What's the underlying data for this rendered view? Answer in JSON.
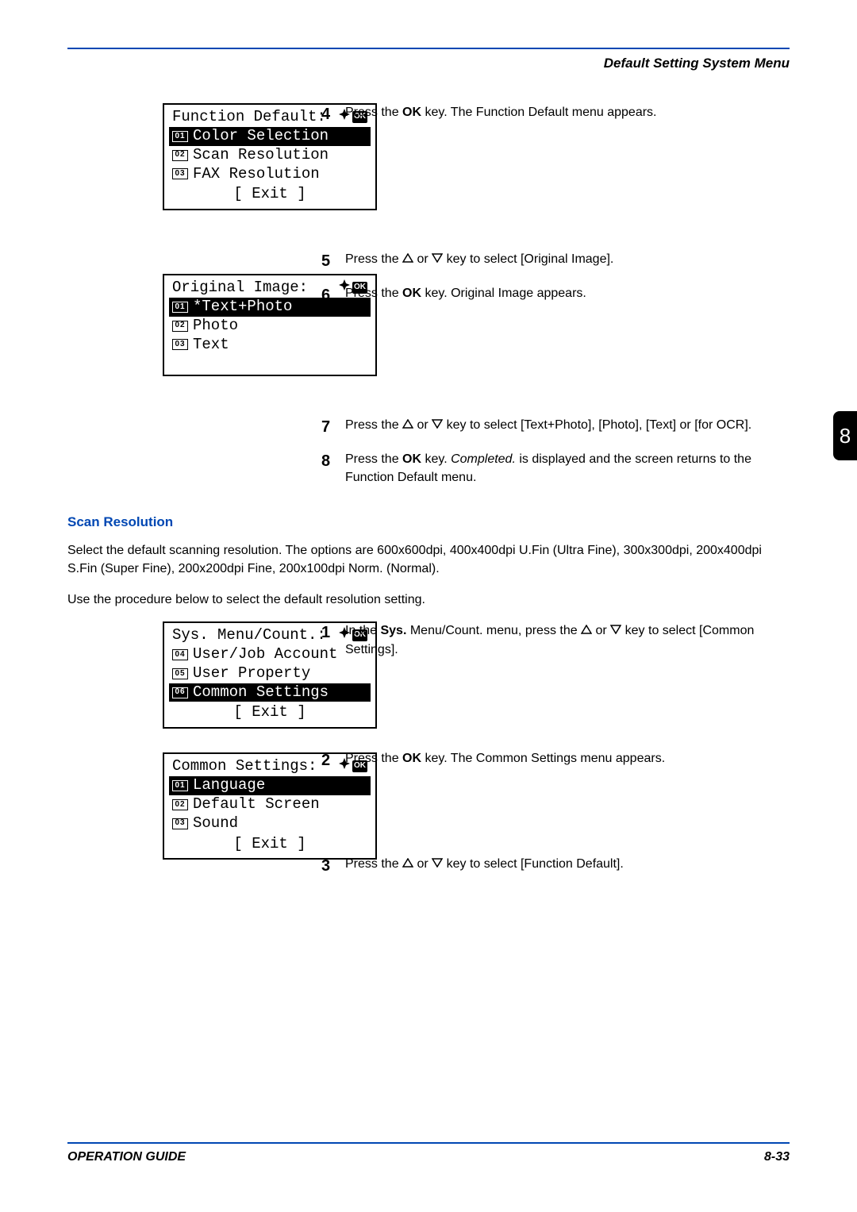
{
  "header": "Default Setting System Menu",
  "chapter": "8",
  "lcd1": {
    "title": "Function Default:",
    "items": [
      {
        "num": "01",
        "label": "Color Selection",
        "selected": true
      },
      {
        "num": "02",
        "label": "Scan Resolution",
        "selected": false
      },
      {
        "num": "03",
        "label": "FAX Resolution",
        "selected": false
      }
    ],
    "footer": "[  Exit   ]"
  },
  "lcd2": {
    "title": "Original Image:",
    "items": [
      {
        "num": "01",
        "label": "*Text+Photo",
        "selected": true
      },
      {
        "num": "02",
        "label": "Photo",
        "selected": false
      },
      {
        "num": "03",
        "label": "Text",
        "selected": false
      }
    ]
  },
  "lcd3": {
    "title": "Sys. Menu/Count.:",
    "items": [
      {
        "num": "04",
        "label": "User/Job Account",
        "selected": false
      },
      {
        "num": "05",
        "label": "User Property",
        "selected": false
      },
      {
        "num": "06",
        "label": "Common Settings",
        "selected": true
      }
    ],
    "footer": "[  Exit   ]"
  },
  "lcd4": {
    "title": "Common Settings:",
    "items": [
      {
        "num": "01",
        "label": "Language",
        "selected": true
      },
      {
        "num": "02",
        "label": "Default Screen",
        "selected": false
      },
      {
        "num": "03",
        "label": "Sound",
        "selected": false
      }
    ],
    "footer": "[  Exit   ]"
  },
  "steps": {
    "s4_num": "4",
    "s4_prefix": "Press the ",
    "s4_bold1": "OK",
    "s4_suffix": " key. The Function Default menu appears.",
    "s5_num": "5",
    "s5_prefix": "Press the ",
    "s5_mid": " or ",
    "s5_suffix": " key to select [Original Image].",
    "s6_num": "6",
    "s6_prefix": "Press the ",
    "s6_bold1": "OK",
    "s6_suffix": " key. Original Image appears.",
    "s7_num": "7",
    "s7_prefix": "Press the ",
    "s7_mid": " or ",
    "s7_suffix": " key to select [Text+Photo], [Photo], [Text] or [for OCR].",
    "s8_num": "8",
    "s8_prefix": "Press the ",
    "s8_bold1": "OK",
    "s8_mid": " key. ",
    "s8_ital": "Completed.",
    "s8_suffix": " is displayed and the screen returns to the Function Default menu.",
    "s1_num": "1",
    "s1_prefix": "In the ",
    "s1_bold1": "Sys.",
    "s1_mid1": " Menu/Count. menu, press the ",
    "s1_mid2": " or ",
    "s1_suffix": " key to select [Common Settings].",
    "s2_num": "2",
    "s2_prefix": "Press the ",
    "s2_bold1": "OK",
    "s2_suffix": " key. The Common Settings menu appears.",
    "s3_num": "3",
    "s3_prefix": "Press the ",
    "s3_mid": " or ",
    "s3_suffix": " key to select [Function Default]."
  },
  "section": {
    "heading": "Scan Resolution",
    "para1": "Select the default scanning resolution. The options are 600x600dpi, 400x400dpi U.Fin (Ultra Fine), 300x300dpi, 200x400dpi S.Fin (Super Fine), 200x200dpi Fine, 200x100dpi Norm. (Normal).",
    "para2": "Use the procedure below to select the default resolution setting."
  },
  "footer": {
    "left": "OPERATION GUIDE",
    "right": "8-33"
  },
  "ok_label": "OK"
}
